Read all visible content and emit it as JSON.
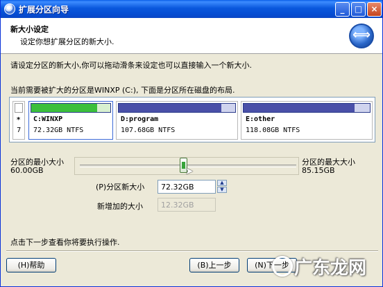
{
  "window": {
    "title": "扩展分区向导",
    "buttons": {
      "minimize": "_",
      "maximize": "□",
      "close": "×"
    }
  },
  "header": {
    "title": "新大小设定",
    "subtitle": "设定你想扩展分区的新大小.",
    "icon": "wizard-arrows-icon"
  },
  "instructions": {
    "line1": "请设定分区的新大小,你可以拖动滑条来设定也可以直接输入一个新大小.",
    "line2": "当前需要被扩大的分区是WINXP (C:), 下面是分区所在磁盘的布局."
  },
  "disk": {
    "unallocated": {
      "mark1": "*",
      "mark2": "7"
    },
    "partitions": [
      {
        "name": "C:WINXP",
        "size": "72.32GB NTFS",
        "color": "#3cbf3c",
        "fill": 0.83,
        "status": "selected"
      },
      {
        "name": "D:program",
        "size": "107.68GB NTFS",
        "color": "#4a50a8",
        "fill": 0.88
      },
      {
        "name": "E:other",
        "size": "118.08GB NTFS",
        "color": "#4a50a8",
        "fill": 0.88
      }
    ]
  },
  "slider": {
    "min_label": "分区的最小大小",
    "min_value": "60.00GB",
    "max_label": "分区的最大大小",
    "max_value": "85.15GB",
    "position_fraction": 0.49
  },
  "new_size": {
    "label": "(P)分区新大小",
    "value": "72.32GB"
  },
  "added_size": {
    "label": "新增加的大小",
    "value": "12.32GB"
  },
  "footer_text": "点击下一步查看你将要执行操作.",
  "buttons": {
    "help": "(H)帮助",
    "back": "(B)上一步",
    "next": "(N)下一步"
  },
  "watermark": "广东龙网"
}
